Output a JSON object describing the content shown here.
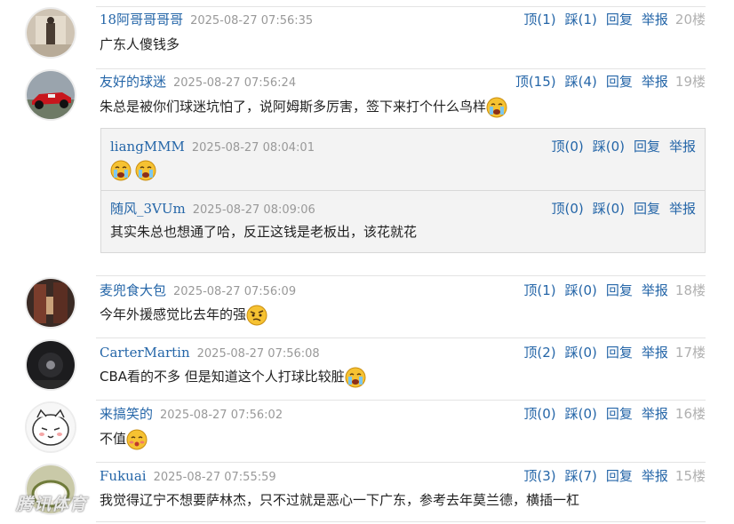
{
  "actions": {
    "up": "顶",
    "down": "踩",
    "reply": "回复",
    "report": "举报"
  },
  "comments": [
    {
      "user": "18阿哥哥哥哥",
      "time": "2025-08-27 07:56:35",
      "up": "顶(1)",
      "down": "踩(1)",
      "floor": "20楼",
      "text": "广东人傻钱多"
    },
    {
      "user": "友好的球迷",
      "time": "2025-08-27 07:56:24",
      "up": "顶(15)",
      "down": "踩(4)",
      "floor": "19楼",
      "text": "朱总是被你们球迷坑怕了，说阿姆斯多厉害，签下来打个什么鸟样",
      "replies": [
        {
          "user": "liangMMM",
          "time": "2025-08-27 08:04:01",
          "up": "顶(0)",
          "down": "踩(0)",
          "text": ""
        },
        {
          "user": "随风_3VUm",
          "time": "2025-08-27 08:09:06",
          "up": "顶(0)",
          "down": "踩(0)",
          "text": "其实朱总也想通了哈，反正这钱是老板出，该花就花"
        }
      ]
    },
    {
      "user": "麦兜食大包",
      "time": "2025-08-27 07:56:09",
      "up": "顶(1)",
      "down": "踩(0)",
      "floor": "18楼",
      "text": "今年外援感觉比去年的强"
    },
    {
      "user": "CarterMartin",
      "time": "2025-08-27 07:56:08",
      "up": "顶(2)",
      "down": "踩(0)",
      "floor": "17楼",
      "text": "CBA看的不多 但是知道这个人打球比较脏"
    },
    {
      "user": "来搞笑的",
      "time": "2025-08-27 07:56:02",
      "up": "顶(0)",
      "down": "踩(0)",
      "floor": "16楼",
      "text": "不值"
    },
    {
      "user": "Fukuai",
      "time": "2025-08-27 07:55:59",
      "up": "顶(3)",
      "down": "踩(7)",
      "floor": "15楼",
      "text": "我觉得辽宁不想要萨林杰，只不过就是恶心一下广东，参考去年莫兰德，横插一杠"
    }
  ],
  "watermark": "腾讯体育",
  "colors": {
    "link": "#2566a8",
    "floor": "#b0b0b0",
    "reply_bg": "#f3f3f3"
  }
}
